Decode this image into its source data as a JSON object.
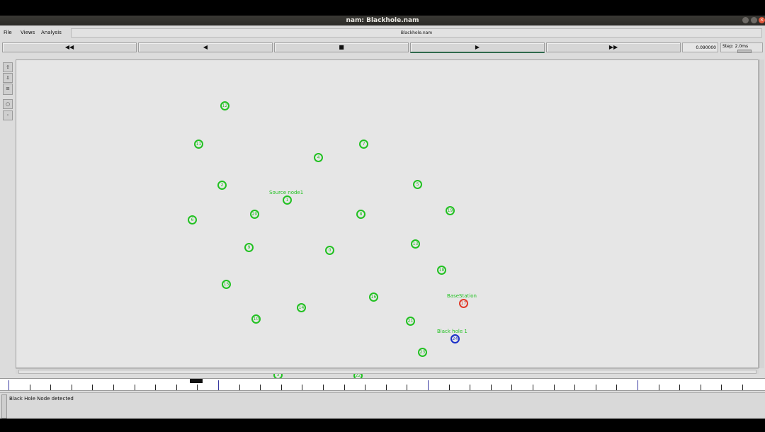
{
  "window": {
    "title": "nam: Blackhole.nam",
    "close_symbol": "×"
  },
  "menu": {
    "file": "File",
    "views": "Views",
    "analysis": "Analysis"
  },
  "filename": "Blackhole.nam",
  "transport": {
    "rewind_fast": "◀◀",
    "rewind": "◀",
    "stop": "■",
    "play": "▶",
    "forward_fast": "▶▶"
  },
  "time_display": "0.090000",
  "step_label": "Step: 2.0ms",
  "timeline": {
    "marker_label": ""
  },
  "status_message": "Black Hole Node detected",
  "colors": {
    "normal_node": "#22c122",
    "base_station": "#e03a2a",
    "black_hole": "#1a2fc8"
  },
  "nodes": [
    {
      "id": "12",
      "type": "normal"
    },
    {
      "id": "11",
      "type": "normal"
    },
    {
      "id": "4",
      "type": "normal"
    },
    {
      "id": "7",
      "type": "normal"
    },
    {
      "id": "2",
      "type": "normal"
    },
    {
      "id": "5",
      "type": "normal"
    },
    {
      "id": "1",
      "type": "normal",
      "label": "Source node1"
    },
    {
      "id": "20",
      "type": "normal"
    },
    {
      "id": "8",
      "type": "normal"
    },
    {
      "id": "19",
      "type": "normal"
    },
    {
      "id": "6",
      "type": "normal"
    },
    {
      "id": "9",
      "type": "normal"
    },
    {
      "id": "0",
      "type": "normal"
    },
    {
      "id": "13",
      "type": "normal"
    },
    {
      "id": "18",
      "type": "normal"
    },
    {
      "id": "15",
      "type": "normal"
    },
    {
      "id": "16",
      "type": "normal"
    },
    {
      "id": "17",
      "type": "base",
      "label": "BaseStation"
    },
    {
      "id": "14",
      "type": "normal"
    },
    {
      "id": "10",
      "type": "normal"
    },
    {
      "id": "21",
      "type": "normal"
    },
    {
      "id": "24",
      "type": "blackhole",
      "label": "Black hole 1"
    },
    {
      "id": "23",
      "type": "normal"
    },
    {
      "id": "3",
      "type": "normal"
    },
    {
      "id": "22",
      "type": "normal"
    }
  ]
}
